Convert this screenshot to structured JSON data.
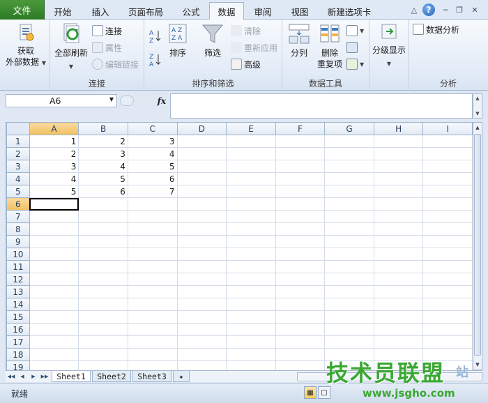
{
  "tabs": {
    "file": "文件",
    "items": [
      "开始",
      "插入",
      "页面布局",
      "公式",
      "数据",
      "审阅",
      "视图",
      "新建选项卡"
    ],
    "active": "数据"
  },
  "window_controls": {
    "help": "?"
  },
  "ribbon": {
    "get_external": {
      "line1": "获取",
      "line2": "外部数据"
    },
    "connections_group": {
      "label": "连接",
      "refresh_all": "全部刷新",
      "connections": "连接",
      "properties": "属性",
      "edit_links": "编辑链接"
    },
    "sort_filter_group": {
      "label": "排序和筛选",
      "sort": "排序",
      "filter": "筛选",
      "clear": "清除",
      "reapply": "重新应用",
      "advanced": "高级"
    },
    "data_tools_group": {
      "label": "数据工具",
      "text_to_columns": "分列",
      "remove_duplicates": {
        "line1": "删除",
        "line2": "重复项"
      }
    },
    "outline_group": {
      "label": "",
      "outline": "分级显示"
    },
    "analysis_group": {
      "label": "分析",
      "data_analysis": "数据分析"
    }
  },
  "formula_bar": {
    "name_box": "A6",
    "fx": "fx",
    "formula": ""
  },
  "grid": {
    "columns": [
      "A",
      "B",
      "C",
      "D",
      "E",
      "F",
      "G",
      "H",
      "I"
    ],
    "selected_column": "A",
    "selected_row": 6,
    "rows": [
      {
        "n": "1",
        "cells": [
          "1",
          "2",
          "3",
          "",
          "",
          "",
          "",
          "",
          ""
        ]
      },
      {
        "n": "2",
        "cells": [
          "2",
          "3",
          "4",
          "",
          "",
          "",
          "",
          "",
          ""
        ]
      },
      {
        "n": "3",
        "cells": [
          "3",
          "4",
          "5",
          "",
          "",
          "",
          "",
          "",
          ""
        ]
      },
      {
        "n": "4",
        "cells": [
          "4",
          "5",
          "6",
          "",
          "",
          "",
          "",
          "",
          ""
        ]
      },
      {
        "n": "5",
        "cells": [
          "5",
          "6",
          "7",
          "",
          "",
          "",
          "",
          "",
          ""
        ]
      },
      {
        "n": "6",
        "cells": [
          "",
          "",
          "",
          "",
          "",
          "",
          "",
          "",
          ""
        ]
      },
      {
        "n": "7",
        "cells": [
          "",
          "",
          "",
          "",
          "",
          "",
          "",
          "",
          ""
        ]
      },
      {
        "n": "8",
        "cells": [
          "",
          "",
          "",
          "",
          "",
          "",
          "",
          "",
          ""
        ]
      },
      {
        "n": "9",
        "cells": [
          "",
          "",
          "",
          "",
          "",
          "",
          "",
          "",
          ""
        ]
      },
      {
        "n": "10",
        "cells": [
          "",
          "",
          "",
          "",
          "",
          "",
          "",
          "",
          ""
        ]
      },
      {
        "n": "11",
        "cells": [
          "",
          "",
          "",
          "",
          "",
          "",
          "",
          "",
          ""
        ]
      },
      {
        "n": "12",
        "cells": [
          "",
          "",
          "",
          "",
          "",
          "",
          "",
          "",
          ""
        ]
      },
      {
        "n": "13",
        "cells": [
          "",
          "",
          "",
          "",
          "",
          "",
          "",
          "",
          ""
        ]
      },
      {
        "n": "14",
        "cells": [
          "",
          "",
          "",
          "",
          "",
          "",
          "",
          "",
          ""
        ]
      },
      {
        "n": "15",
        "cells": [
          "",
          "",
          "",
          "",
          "",
          "",
          "",
          "",
          ""
        ]
      },
      {
        "n": "16",
        "cells": [
          "",
          "",
          "",
          "",
          "",
          "",
          "",
          "",
          ""
        ]
      },
      {
        "n": "17",
        "cells": [
          "",
          "",
          "",
          "",
          "",
          "",
          "",
          "",
          ""
        ]
      },
      {
        "n": "18",
        "cells": [
          "",
          "",
          "",
          "",
          "",
          "",
          "",
          "",
          ""
        ]
      },
      {
        "n": "19",
        "cells": [
          "",
          "",
          "",
          "",
          "",
          "",
          "",
          "",
          ""
        ]
      }
    ]
  },
  "sheets": {
    "items": [
      "Sheet1",
      "Sheet2",
      "Sheet3"
    ],
    "active": "Sheet1"
  },
  "status": {
    "text": "就绪"
  },
  "watermark": {
    "main": "技术员联盟",
    "url": "www.jsgho.com",
    "tail": "站"
  },
  "colors": {
    "file_tab": "#2d7a25",
    "selection_header": "#f1c15f",
    "accent": "#2462b7"
  },
  "icons": [
    "get-external-data-icon",
    "refresh-all-icon",
    "connections-icon",
    "properties-icon",
    "edit-links-icon",
    "sort-az-icon",
    "sort-za-icon",
    "sort-dialog-icon",
    "filter-funnel-icon",
    "clear-icon",
    "reapply-icon",
    "advanced-icon",
    "text-to-columns-icon",
    "remove-duplicates-icon",
    "data-validation-icon",
    "consolidate-icon",
    "what-if-icon",
    "outline-icon",
    "data-analysis-icon"
  ]
}
